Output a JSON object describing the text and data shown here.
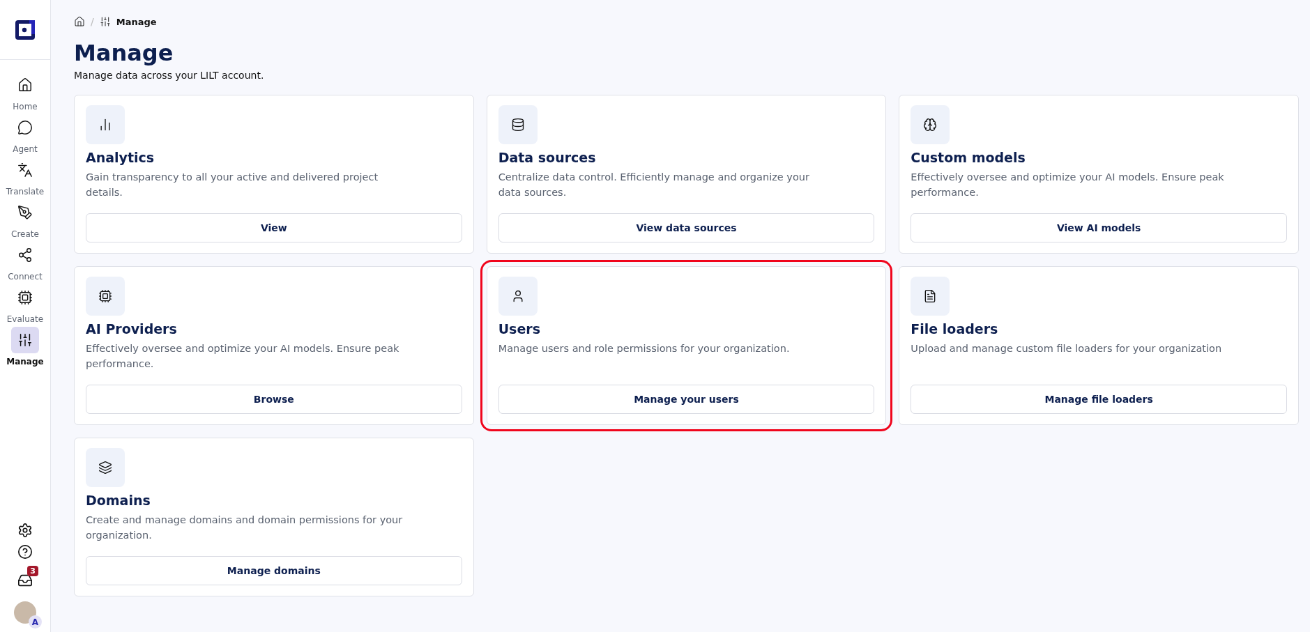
{
  "breadcrumb": {
    "separator": "/",
    "current": "Manage"
  },
  "page": {
    "title": "Manage",
    "subtitle": "Manage data across your LILT account."
  },
  "sidebar": {
    "items": [
      {
        "label": "Home",
        "selected": false
      },
      {
        "label": "Agent",
        "selected": false
      },
      {
        "label": "Translate",
        "selected": false
      },
      {
        "label": "Create",
        "selected": false
      },
      {
        "label": "Connect",
        "selected": false
      },
      {
        "label": "Evaluate",
        "selected": false
      },
      {
        "label": "Manage",
        "selected": true
      }
    ],
    "inbox_badge": "3",
    "avatar_badge": "A"
  },
  "cards": [
    {
      "title": "Analytics",
      "description": "Gain transparency to all your active and delivered project details.",
      "button": "View",
      "highlighted": false
    },
    {
      "title": "Data sources",
      "description": "Centralize data control. Efficiently manage and organize your data sources.",
      "button": "View data sources",
      "highlighted": false
    },
    {
      "title": "Custom models",
      "description": "Effectively oversee and optimize your AI models. Ensure peak performance.",
      "button": "View AI models",
      "highlighted": false
    },
    {
      "title": "AI Providers",
      "description": "Effectively oversee and optimize your AI models. Ensure peak performance.",
      "button": "Browse",
      "highlighted": false
    },
    {
      "title": "Users",
      "description": "Manage users and role permissions for your organization.",
      "button": "Manage your users",
      "highlighted": true
    },
    {
      "title": "File loaders",
      "description": "Upload and manage custom file loaders for your organization",
      "button": "Manage file loaders",
      "highlighted": false
    },
    {
      "title": "Domains",
      "description": "Create and manage domains and domain permissions for your organization.",
      "button": "Manage domains",
      "highlighted": false
    }
  ]
}
